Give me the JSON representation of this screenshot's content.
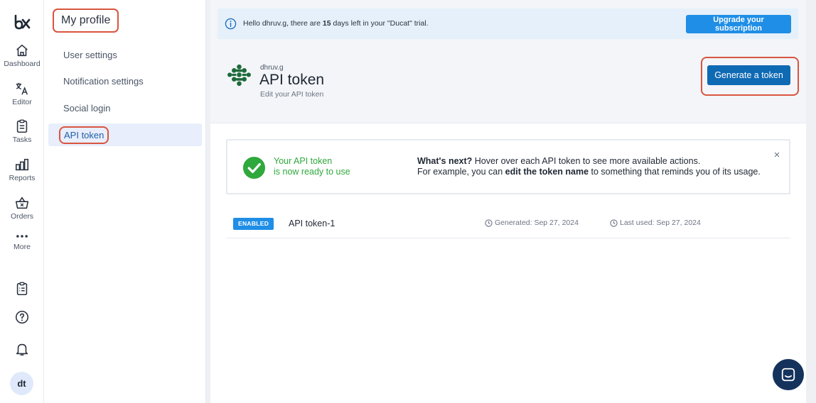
{
  "rail": {
    "items": [
      {
        "label": "Dashboard",
        "icon": "home-icon"
      },
      {
        "label": "Editor",
        "icon": "translate-icon"
      },
      {
        "label": "Tasks",
        "icon": "clipboard-icon"
      },
      {
        "label": "Reports",
        "icon": "bar-chart-icon"
      },
      {
        "label": "Orders",
        "icon": "basket-icon"
      },
      {
        "label": "More",
        "icon": "more-dots-icon"
      }
    ],
    "avatar_initials": "dt"
  },
  "sidebar": {
    "title": "My profile",
    "items": [
      {
        "label": "User settings"
      },
      {
        "label": "Notification settings"
      },
      {
        "label": "Social login"
      },
      {
        "label": "API token"
      }
    ]
  },
  "trial_banner": {
    "prefix": "Hello dhruv.g, there are ",
    "days": "15",
    "suffix": " days left in your \"Ducat\" trial.",
    "button_label": "Upgrade your subscription"
  },
  "page": {
    "username": "dhruv.g",
    "title": "API token",
    "subtitle": "Edit your API token",
    "generate_label": "Generate a token"
  },
  "notice": {
    "line1": "Your API token",
    "line2": "is now ready to use",
    "next_bold": "What's next?",
    "next_rest": " Hover over each API token to see more available actions.",
    "example_prefix": "For example, you can ",
    "example_bold": "edit the token name",
    "example_suffix": " to something that reminds you of its usage.",
    "close": "×"
  },
  "tokens": [
    {
      "status": "ENABLED",
      "name": "API token-1",
      "generated": "Generated: Sep 27, 2024",
      "last_used": "Last used: Sep 27, 2024"
    }
  ],
  "colors": {
    "accent": "#0f6ab4",
    "badge": "#1f8ee6",
    "success": "#2fa83c",
    "highlight": "#d9553f"
  }
}
